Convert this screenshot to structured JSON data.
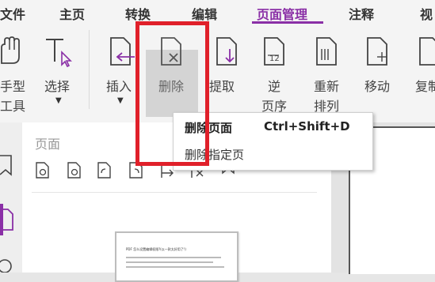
{
  "menubar": {
    "items": [
      "文件",
      "主页",
      "转换",
      "编辑",
      "页面管理",
      "注释",
      "视"
    ],
    "active": "页面管理"
  },
  "ribbon": {
    "tools": [
      {
        "label_line1": "手型",
        "label_line2": "工具",
        "icon": "hand-icon"
      },
      {
        "label_line1": "选择",
        "icon": "text-select-icon"
      },
      {
        "label_line1": "插入",
        "icon": "insert-page-icon"
      },
      {
        "label_line1": "删除",
        "icon": "delete-page-icon"
      },
      {
        "label_line1": "提取",
        "icon": "extract-page-icon"
      },
      {
        "label_line1": "逆",
        "label_line2": "页序",
        "icon": "reverse-order-icon"
      },
      {
        "label_line1": "重新",
        "label_line2": "排列",
        "icon": "reorder-icon"
      },
      {
        "label_line1": "移动",
        "icon": "move-page-icon"
      },
      {
        "label_line1": "复制",
        "icon": "copy-page-icon"
      }
    ]
  },
  "tooltip": {
    "title": "删除页面",
    "shortcut": "Ctrl+Shift+D",
    "description": "删除指定页"
  },
  "page_panel": {
    "title": "页面",
    "thumbnail_text": "PDF 怎么设置编辑权限?(以一款太好用了!)"
  },
  "colors": {
    "accent": "#8a2fa6",
    "highlight_box": "#e0202a"
  }
}
